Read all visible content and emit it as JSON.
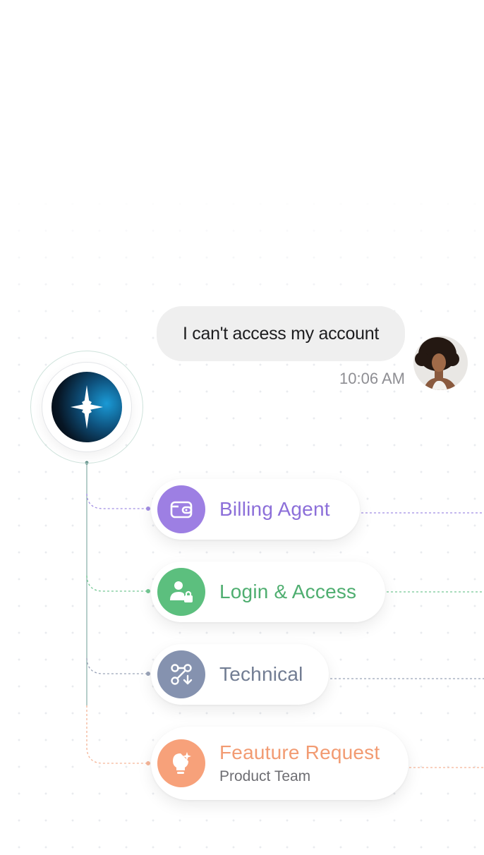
{
  "chat": {
    "message": "I can't access my account",
    "time": "10:06 AM"
  },
  "routes": [
    {
      "label": "Billing Agent",
      "sublabel": "",
      "icon": "wallet-icon",
      "color": "#9d7fe3",
      "text_color": "#8c6fd9"
    },
    {
      "label": "Login & Access",
      "sublabel": "",
      "icon": "user-lock-icon",
      "color": "#5cbf7e",
      "text_color": "#4fae70"
    },
    {
      "label": "Technical",
      "sublabel": "",
      "icon": "route-nodes-icon",
      "color": "#8592af",
      "text_color": "#727d93"
    },
    {
      "label": "Feauture Request",
      "sublabel": "Product Team",
      "icon": "lightbulb-sparkle-icon",
      "color": "#f7a17a",
      "text_color": "#f29b72"
    }
  ],
  "colors": {
    "bubble_bg": "#efefef",
    "line_billing": "#a18de3",
    "line_login": "#73c793",
    "line_technical": "#9aa3b8",
    "line_feature": "#f5b598",
    "trunk": "#8fb3ad"
  }
}
